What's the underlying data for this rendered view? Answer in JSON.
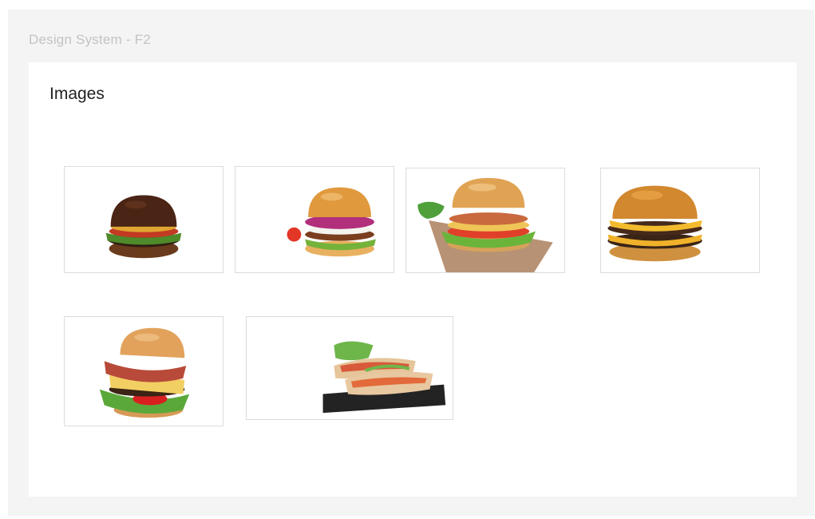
{
  "frame": {
    "title": "Design System - F2"
  },
  "panel": {
    "title": "Images"
  },
  "images": [
    {
      "name": "burger-image-1",
      "subject": "classic-burger-icon"
    },
    {
      "name": "burger-image-2",
      "subject": "burger-with-onions-icon"
    },
    {
      "name": "burger-image-3",
      "subject": "burger-on-paper-icon"
    },
    {
      "name": "burger-image-4",
      "subject": "cheeseburger-icon"
    },
    {
      "name": "burger-image-5",
      "subject": "bacon-burger-icon"
    },
    {
      "name": "wraps-image",
      "subject": "pita-wraps-icon"
    }
  ],
  "colors": {
    "frame_bg": "#f4f4f4",
    "panel_bg": "#ffffff",
    "tile_border": "#dcdcdc",
    "title_muted": "#c3c3c3",
    "heading": "#222222"
  }
}
